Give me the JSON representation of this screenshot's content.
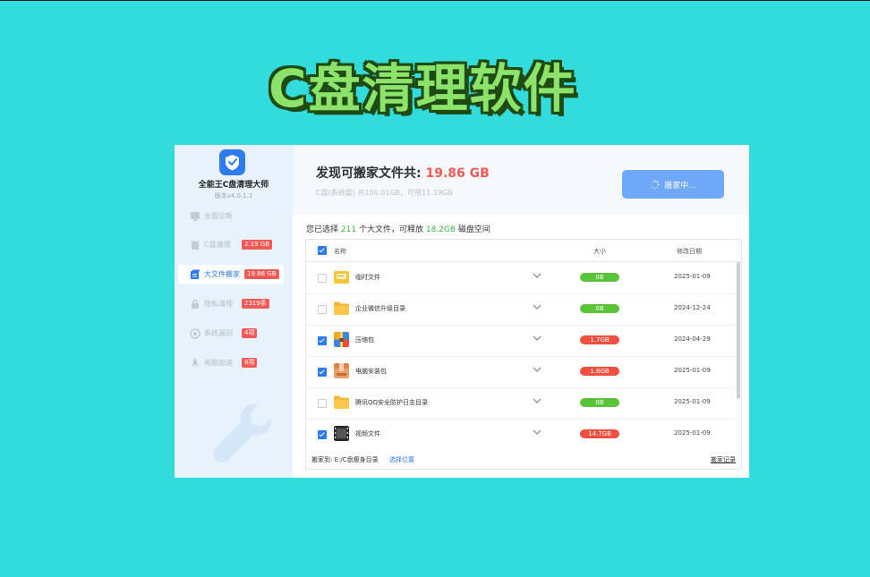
{
  "headline": "C盘清理软件",
  "app": {
    "title": "全能王C盘清理大师",
    "version": "版本v4.0.1.1",
    "accent": "#2e7bf0"
  },
  "sidebar": {
    "items": [
      {
        "label": "全面诊断",
        "icon": "monitor-icon",
        "badge": ""
      },
      {
        "label": "C盘清理",
        "icon": "trash-icon",
        "badge": "2.19 GB"
      },
      {
        "label": "大文件搬家",
        "icon": "file-stack-icon",
        "badge": "19.86 GB",
        "active": true
      },
      {
        "label": "隐私清理",
        "icon": "lock-icon",
        "badge": "2319条"
      },
      {
        "label": "系统漏洞",
        "icon": "shield-icon",
        "badge": "4项"
      },
      {
        "label": "电脑加速",
        "icon": "rocket-icon",
        "badge": "8项"
      }
    ]
  },
  "header": {
    "found_label": "发现可搬家文件共:",
    "found_size": "19.86 GB",
    "disk_info": "C盘(系统盘) 共100.01GB，可用11.19GB",
    "move_button": "搬家中..."
  },
  "summary": {
    "prefix": "您已选择",
    "count": "211",
    "middle": "个大文件，可释放",
    "size": "18.2GB",
    "suffix": "磁盘空间"
  },
  "table": {
    "columns": {
      "name": "名称",
      "size": "大小",
      "date": "修改日期"
    },
    "rows": [
      {
        "name": "临时文件",
        "icon": "temp-folder-icon",
        "checked": false,
        "size": "0B",
        "size_status": "green",
        "date": "2025-01-09"
      },
      {
        "name": "企业微信升级目录",
        "icon": "folder-icon",
        "checked": false,
        "size": "0B",
        "size_status": "green",
        "date": "2024-12-24"
      },
      {
        "name": "压缩包",
        "icon": "archive-icon",
        "checked": true,
        "size": "1.7GB",
        "size_status": "red",
        "date": "2024-04-29"
      },
      {
        "name": "电脑安装包",
        "icon": "package-icon",
        "checked": true,
        "size": "1.8GB",
        "size_status": "red",
        "date": "2025-01-09"
      },
      {
        "name": "腾讯QQ安全防护日志目录",
        "icon": "folder-icon",
        "checked": false,
        "size": "0B",
        "size_status": "green",
        "date": "2025-01-09"
      },
      {
        "name": "视频文件",
        "icon": "video-file-icon",
        "checked": true,
        "size": "14.7GB",
        "size_status": "red",
        "date": "2025-01-09"
      }
    ]
  },
  "footer": {
    "move_to": "搬家到:  E:/C盘瘦身目录",
    "choose_location": "选择位置",
    "history": "搬家记录"
  }
}
